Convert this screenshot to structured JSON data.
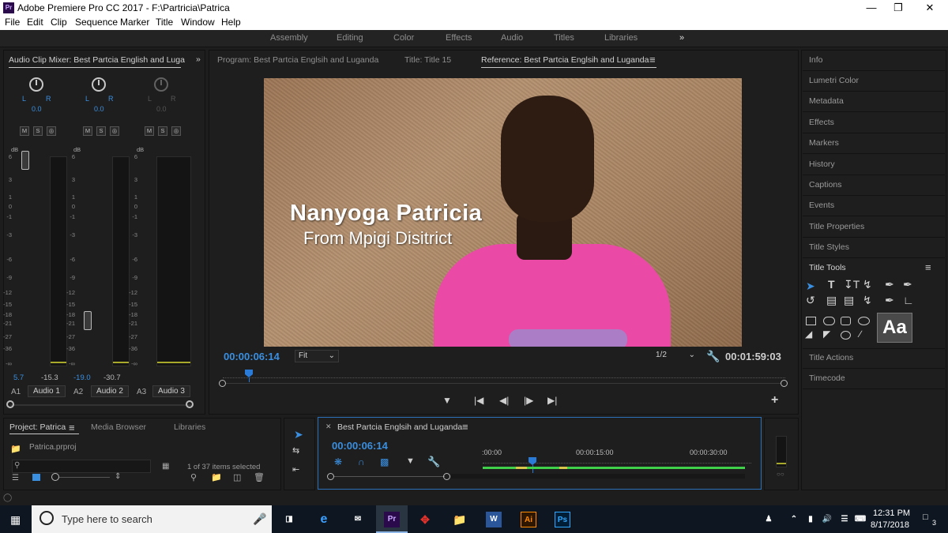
{
  "window": {
    "title": "Adobe Premiere Pro CC 2017 - F:\\Partricia\\Patrica",
    "app_badge": "Pr"
  },
  "menu": [
    "File",
    "Edit",
    "Clip",
    "Sequence",
    "Marker",
    "Title",
    "Window",
    "Help"
  ],
  "workspaces": [
    "Assembly",
    "Editing",
    "Color",
    "Effects",
    "Audio",
    "Titles",
    "Libraries",
    "»"
  ],
  "mixer": {
    "tab": "Audio Clip Mixer: Best Partcia English and Luga",
    "overflow": "»",
    "channels": [
      {
        "pan_value": "0.0",
        "peak_left": "5.7",
        "peak_right": "-15.3",
        "track": "A1",
        "name": "Audio 1"
      },
      {
        "pan_value": "0.0",
        "peak_left": "-19.0",
        "peak_right": "-30.7",
        "track": "A2",
        "name": "Audio 2"
      },
      {
        "pan_value": "0.0",
        "peak_left": "",
        "peak_right": "",
        "track": "A3",
        "name": "Audio 3"
      }
    ],
    "db_label": "dB",
    "scale": [
      "6",
      "3",
      "1",
      "0",
      "-1",
      "-3",
      "-6",
      "-9",
      "-12",
      "-15",
      "-18",
      "-21",
      "-27",
      "-36",
      "-∞"
    ],
    "m": "M",
    "s": "S",
    "r": "◎",
    "l": "L",
    "rr": "R"
  },
  "monitor": {
    "tabs": [
      "Program: Best Partcia Englsih and Luganda",
      "Title: Title 15",
      "Reference: Best Partcia Englsih and Luganda"
    ],
    "caption_name": "Nanyoga Patricia",
    "caption_sub": "From Mpigi Disitrict",
    "timecode": "00:00:06:14",
    "fit": "Fit",
    "resolution": "1/2",
    "duration": "00:01:59:03",
    "menu_icon": "≡",
    "plus": "+"
  },
  "right_panel": {
    "items": [
      "Info",
      "Lumetri Color",
      "Metadata",
      "Effects",
      "Markers",
      "History",
      "Captions",
      "Events",
      "Title Properties",
      "Title Styles"
    ],
    "title_tools": "Title Tools",
    "title_actions": "Title Actions",
    "timecode": "Timecode",
    "aa": "Aa"
  },
  "project": {
    "tabs": [
      "Project: Patrica",
      "Media Browser",
      "Libraries"
    ],
    "file": "Patrica.prproj",
    "selected": "1 of 37 items selected",
    "search_placeholder": ""
  },
  "timeline": {
    "tab": "Best Partcia Englsih and Luganda",
    "timecode": "00:00:06:14",
    "ruler": [
      ":00:00",
      "00:00:15:00",
      "00:00:30:00"
    ]
  },
  "taskbar": {
    "search": "Type here to search",
    "time": "12:31 PM",
    "date": "8/17/2018",
    "notif": "3",
    "apps": [
      "Pr",
      "Ai",
      "Ps",
      "W"
    ]
  },
  "colors": {
    "accent_blue": "#3a8fe0",
    "playhead": "#2a7bd8",
    "track_green": "#3fd14a",
    "shirt_pink": "#ea4aa6"
  }
}
